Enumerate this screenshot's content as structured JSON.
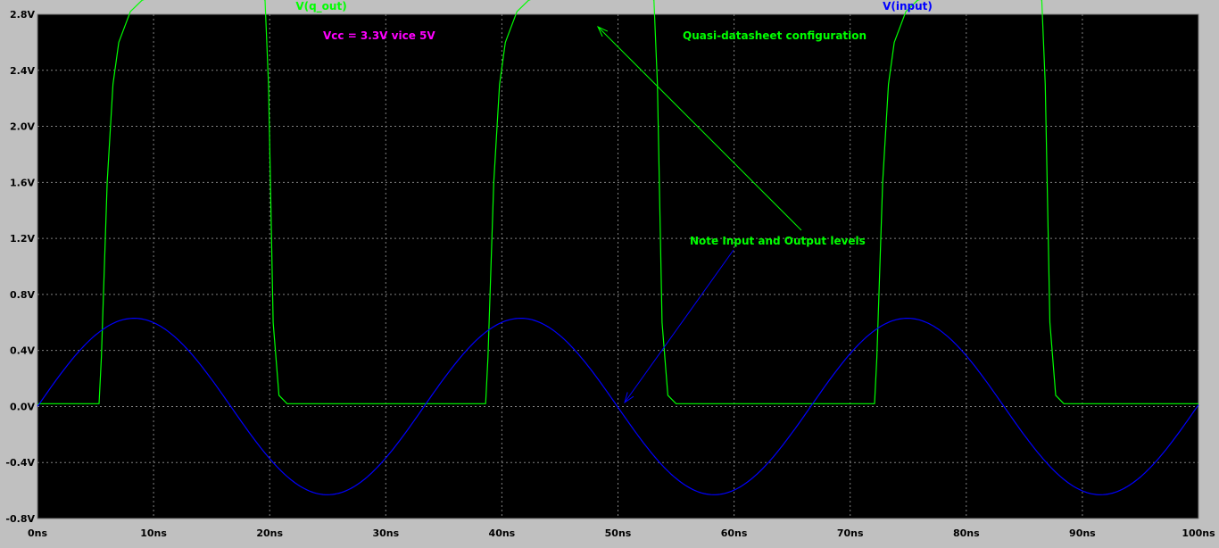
{
  "colors": {
    "frame": "#c0c0c0",
    "plot_background": "#000000",
    "grid": "#808080",
    "q_out": "#00ff00",
    "input": "#0000ff",
    "arrow": "#00ff00",
    "note_vcc": "#ff00ff",
    "note_config": "#00ff00",
    "note_levels": "#00ff00",
    "arrow_levels": "#0000ff"
  },
  "chart_data": {
    "type": "line",
    "title": "",
    "xlabel": "",
    "ylabel": "",
    "xlim": [
      0,
      100
    ],
    "ylim": [
      -0.8,
      2.8
    ],
    "grid": true,
    "x_ticks": [
      0,
      10,
      20,
      30,
      40,
      50,
      60,
      70,
      80,
      90,
      100
    ],
    "x_tick_labels": [
      "0ns",
      "10ns",
      "20ns",
      "30ns",
      "40ns",
      "50ns",
      "60ns",
      "70ns",
      "80ns",
      "90ns",
      "100ns"
    ],
    "y_ticks": [
      2.8,
      2.4,
      2.0,
      1.6,
      1.2,
      0.8,
      0.4,
      0.0,
      -0.4,
      -0.8
    ],
    "y_tick_labels": [
      "2.8V",
      "2.4V",
      "2.0V",
      "1.6V",
      "1.2V",
      "0.8V",
      "0.4V",
      "0.0V",
      "-0.4V",
      "-0.8V"
    ],
    "trace_labels": {
      "q_out": "V(q_out)",
      "input": "V(input)"
    },
    "series": [
      {
        "name": "V(q_out)",
        "x": [
          0,
          5.3,
          5.5,
          6.0,
          6.5,
          7.0,
          8.0,
          9.0,
          10.0,
          12.0,
          15.0,
          19.0,
          19.6,
          19.9,
          20.3,
          20.8,
          21.5,
          38.6,
          38.8,
          39.3,
          39.8,
          40.3,
          41.3,
          42.3,
          43.3,
          45.0,
          48.0,
          52.5,
          53.1,
          53.4,
          53.8,
          54.3,
          55.0,
          72.1,
          72.3,
          72.8,
          73.3,
          73.8,
          74.8,
          75.8,
          76.8,
          78.5,
          81.5,
          85.9,
          86.5,
          86.8,
          87.2,
          87.7,
          88.4,
          100
        ],
        "y": [
          0.02,
          0.02,
          0.35,
          1.6,
          2.3,
          2.6,
          2.82,
          2.9,
          2.93,
          2.95,
          2.95,
          2.95,
          2.9,
          2.3,
          0.6,
          0.08,
          0.02,
          0.02,
          0.35,
          1.6,
          2.3,
          2.6,
          2.82,
          2.9,
          2.93,
          2.95,
          2.95,
          2.95,
          2.9,
          2.3,
          0.6,
          0.08,
          0.02,
          0.02,
          0.35,
          1.6,
          2.3,
          2.6,
          2.82,
          2.9,
          2.93,
          2.95,
          2.95,
          2.95,
          2.9,
          2.3,
          0.6,
          0.08,
          0.02,
          0.02
        ]
      },
      {
        "name": "V(input)",
        "function": "sine",
        "amplitude": 0.63,
        "offset": 0.0,
        "period_ns": 33.3,
        "phase_ns": 0
      }
    ],
    "annotations": {
      "vcc": {
        "text": "Vcc = 3.3V vice 5V"
      },
      "config": {
        "text": "Quasi-datasheet configuration"
      },
      "levels": {
        "text": "Note Input and Output levels"
      }
    }
  }
}
